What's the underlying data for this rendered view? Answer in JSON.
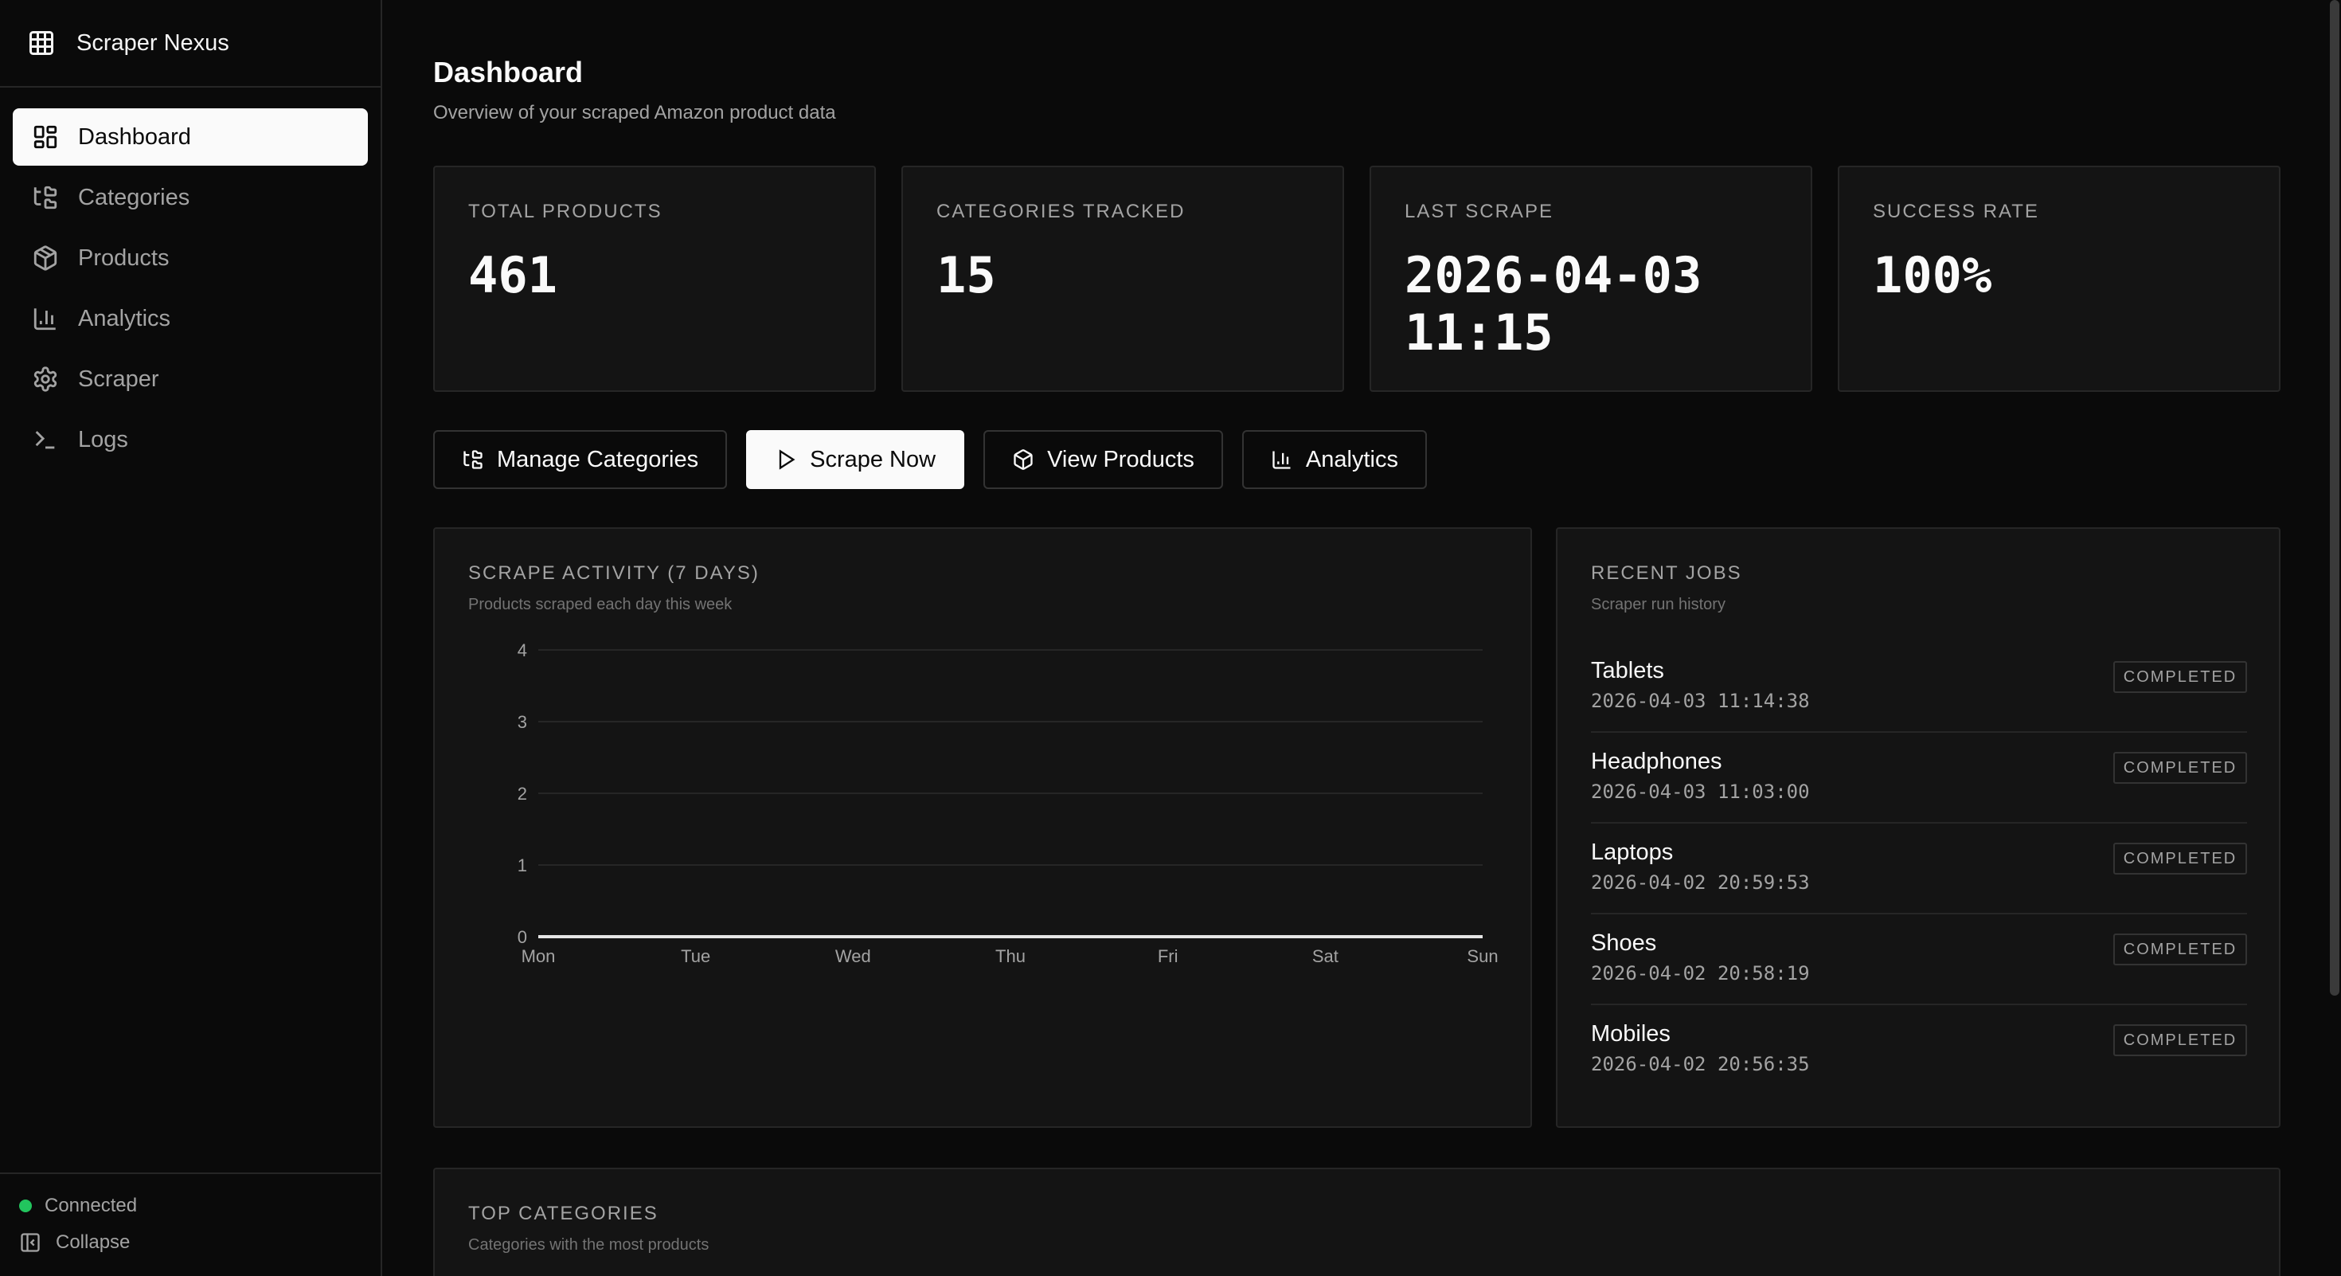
{
  "app": {
    "name": "Scraper Nexus"
  },
  "sidebar": {
    "items": [
      {
        "label": "Dashboard",
        "icon": "dashboard-icon",
        "active": true
      },
      {
        "label": "Categories",
        "icon": "categories-icon"
      },
      {
        "label": "Products",
        "icon": "package-icon"
      },
      {
        "label": "Analytics",
        "icon": "bar-chart-icon"
      },
      {
        "label": "Scraper",
        "icon": "gear-icon"
      },
      {
        "label": "Logs",
        "icon": "terminal-icon"
      }
    ],
    "status": "Connected",
    "status_color": "#22c55e",
    "collapse_label": "Collapse"
  },
  "header": {
    "title": "Dashboard",
    "subtitle": "Overview of your scraped Amazon product data"
  },
  "stats": [
    {
      "label": "TOTAL PRODUCTS",
      "value": "461"
    },
    {
      "label": "CATEGORIES TRACKED",
      "value": "15"
    },
    {
      "label": "LAST SCRAPE",
      "value": "2026-04-03\n11:15"
    },
    {
      "label": "SUCCESS RATE",
      "value": "100%"
    }
  ],
  "actions": {
    "manage_categories": "Manage Categories",
    "scrape_now": "Scrape Now",
    "view_products": "View Products",
    "analytics": "Analytics"
  },
  "activity": {
    "title": "SCRAPE ACTIVITY (7 DAYS)",
    "subtitle": "Products scraped each day this week"
  },
  "chart_data": {
    "type": "line",
    "title": "SCRAPE ACTIVITY (7 DAYS)",
    "subtitle": "Products scraped each day this week",
    "categories": [
      "Mon",
      "Tue",
      "Wed",
      "Thu",
      "Fri",
      "Sat",
      "Sun"
    ],
    "values": [
      0,
      0,
      0,
      0,
      0,
      0,
      0
    ],
    "yticks": [
      0,
      1,
      2,
      3,
      4
    ],
    "ylim": [
      0,
      4
    ],
    "grid": true,
    "line_color": "#e5e5e5"
  },
  "recent_jobs": {
    "title": "RECENT JOBS",
    "subtitle": "Scraper run history",
    "items": [
      {
        "name": "Tablets",
        "time": "2026-04-03 11:14:38",
        "status": "COMPLETED"
      },
      {
        "name": "Headphones",
        "time": "2026-04-03 11:03:00",
        "status": "COMPLETED"
      },
      {
        "name": "Laptops",
        "time": "2026-04-02 20:59:53",
        "status": "COMPLETED"
      },
      {
        "name": "Shoes",
        "time": "2026-04-02 20:58:19",
        "status": "COMPLETED"
      },
      {
        "name": "Mobiles",
        "time": "2026-04-02 20:56:35",
        "status": "COMPLETED"
      }
    ]
  },
  "top_categories": {
    "title": "TOP CATEGORIES",
    "subtitle": "Categories with the most products"
  }
}
